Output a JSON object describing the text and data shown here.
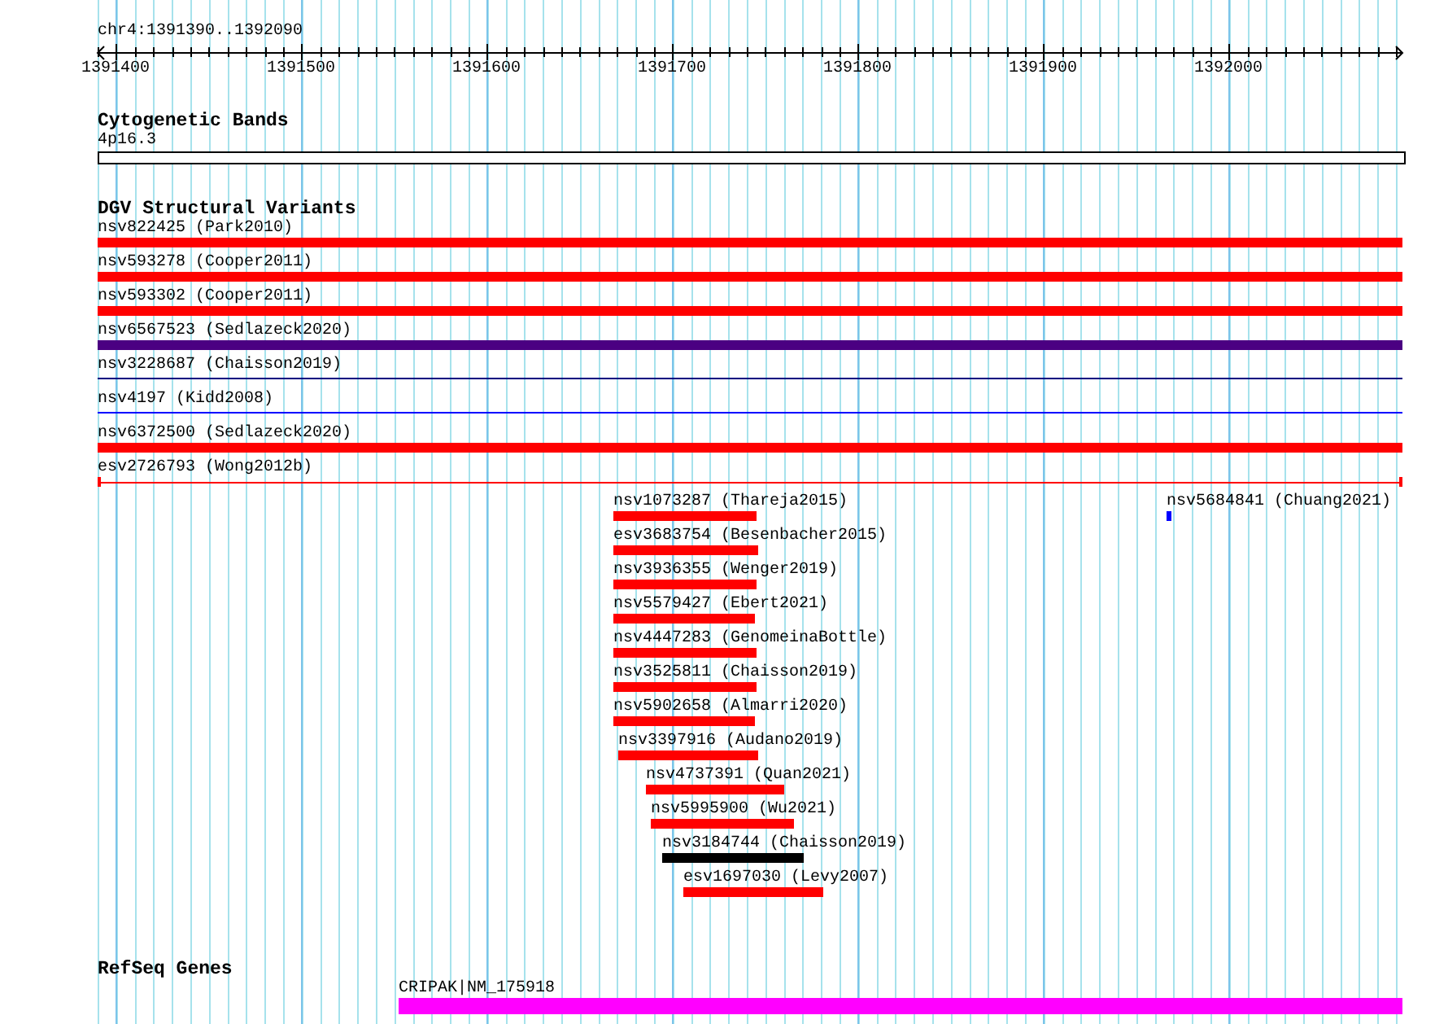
{
  "ruler": {
    "title": "chr4:1391390..1392090",
    "ticks": [
      "1391400",
      "1391500",
      "1391600",
      "1391700",
      "1391800",
      "1391900",
      "1392000"
    ]
  },
  "cytobands": {
    "title": "Cytogenetic Bands",
    "band": "4p16.3"
  },
  "variants": {
    "title": "DGV Structural Variants",
    "rows": [
      [
        {
          "label": "nsv822425 (Park2010)",
          "kind": "thick",
          "color": "#ff0000"
        }
      ],
      [
        {
          "label": "nsv593278 (Cooper2011)",
          "kind": "thick",
          "color": "#ff0000"
        }
      ],
      [
        {
          "label": "nsv593302 (Cooper2011)",
          "kind": "thick",
          "color": "#ff0000"
        }
      ],
      [
        {
          "label": "nsv6567523 (Sedlazeck2020)",
          "kind": "thick",
          "color": "#4b0082"
        }
      ],
      [
        {
          "label": "nsv3228687 (Chaisson2019)",
          "kind": "line",
          "color": "#000080"
        }
      ],
      [
        {
          "label": "nsv4197 (Kidd2008)",
          "kind": "line",
          "color": "#0000ff"
        }
      ],
      [
        {
          "label": "nsv6372500 (Sedlazeck2020)",
          "kind": "thick",
          "color": "#ff0000"
        }
      ],
      [
        {
          "label": "esv2726793 (Wong2012b)",
          "kind": "bracket",
          "color": "#ff0000"
        }
      ],
      [
        {
          "label": "nsv1073287 (Thareja2015)",
          "kind": "thick",
          "color": "#ff0000"
        },
        {
          "label": "nsv5684841 (Chuang2021)",
          "kind": "thick",
          "color": "#0000ff"
        }
      ],
      [
        {
          "label": "esv3683754 (Besenbacher2015)",
          "kind": "thick",
          "color": "#ff0000"
        }
      ],
      [
        {
          "label": "nsv3936355 (Wenger2019)",
          "kind": "thick",
          "color": "#ff0000"
        }
      ],
      [
        {
          "label": "nsv5579427 (Ebert2021)",
          "kind": "thick",
          "color": "#ff0000"
        }
      ],
      [
        {
          "label": "nsv4447283 (GenomeinaBottle)",
          "kind": "thick",
          "color": "#ff0000"
        }
      ],
      [
        {
          "label": "nsv3525811 (Chaisson2019)",
          "kind": "thick",
          "color": "#ff0000"
        }
      ],
      [
        {
          "label": "nsv5902658 (Almarri2020)",
          "kind": "thick",
          "color": "#ff0000"
        }
      ],
      [
        {
          "label": "nsv3397916 (Audano2019)",
          "kind": "thick",
          "color": "#ff0000"
        }
      ],
      [
        {
          "label": "nsv4737391 (Quan2021)",
          "kind": "thick",
          "color": "#ff0000"
        }
      ],
      [
        {
          "label": "nsv5995900 (Wu2021)",
          "kind": "thick",
          "color": "#ff0000"
        }
      ],
      [
        {
          "label": "nsv3184744 (Chaisson2019)",
          "kind": "thick",
          "color": "#000000"
        }
      ],
      [
        {
          "label": "esv1697030 (Levy2007)",
          "kind": "thick",
          "color": "#ff0000"
        }
      ]
    ]
  },
  "genes": {
    "title": "RefSeq Genes",
    "items": [
      {
        "label": "CRIPAK|NM_175918",
        "color": "#ff00ff"
      }
    ]
  }
}
